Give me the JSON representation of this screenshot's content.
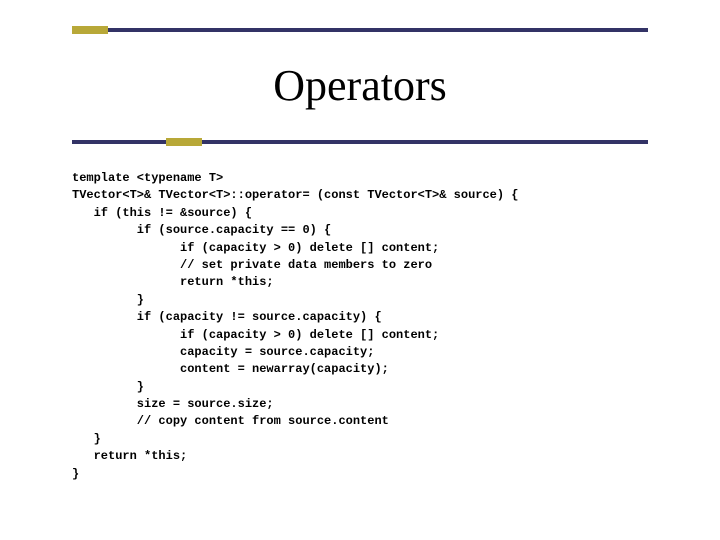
{
  "title": "Operators",
  "code": "template <typename T>\nTVector<T>& TVector<T>::operator= (const TVector<T>& source) {\n   if (this != &source) {\n         if (source.capacity == 0) {\n               if (capacity > 0) delete [] content;\n               // set private data members to zero\n               return *this;\n         }\n         if (capacity != source.capacity) {\n               if (capacity > 0) delete [] content;\n               capacity = source.capacity;\n               content = newarray(capacity);\n         }\n         size = source.size;\n         // copy content from source.content\n   }\n   return *this;\n}"
}
